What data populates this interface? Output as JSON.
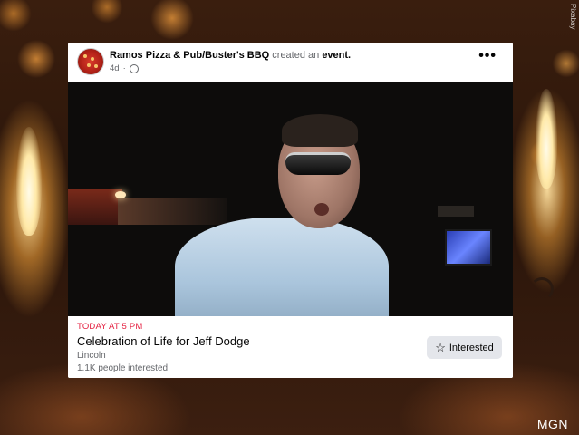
{
  "background": {
    "watermark": "Pixabay",
    "badge": "MGN"
  },
  "post": {
    "page_name": "Ramos Pizza & Pub/Buster's BBQ",
    "action_text": " created an ",
    "action_object": "event.",
    "time_ago": "4d",
    "more_label": "•••",
    "photo_alt": "Photo of a man in sunglasses and a light blue shirt"
  },
  "event": {
    "time": "TODAY AT 5 PM",
    "title": "Celebration of Life for Jeff Dodge",
    "location": "Lincoln",
    "interested_count": "1.1K people interested",
    "button_label": "Interested",
    "button_icon": "star-icon"
  },
  "colors": {
    "accent_red": "#e41e3f",
    "button_bg": "#e4e6eb",
    "secondary_text": "#65676b"
  }
}
